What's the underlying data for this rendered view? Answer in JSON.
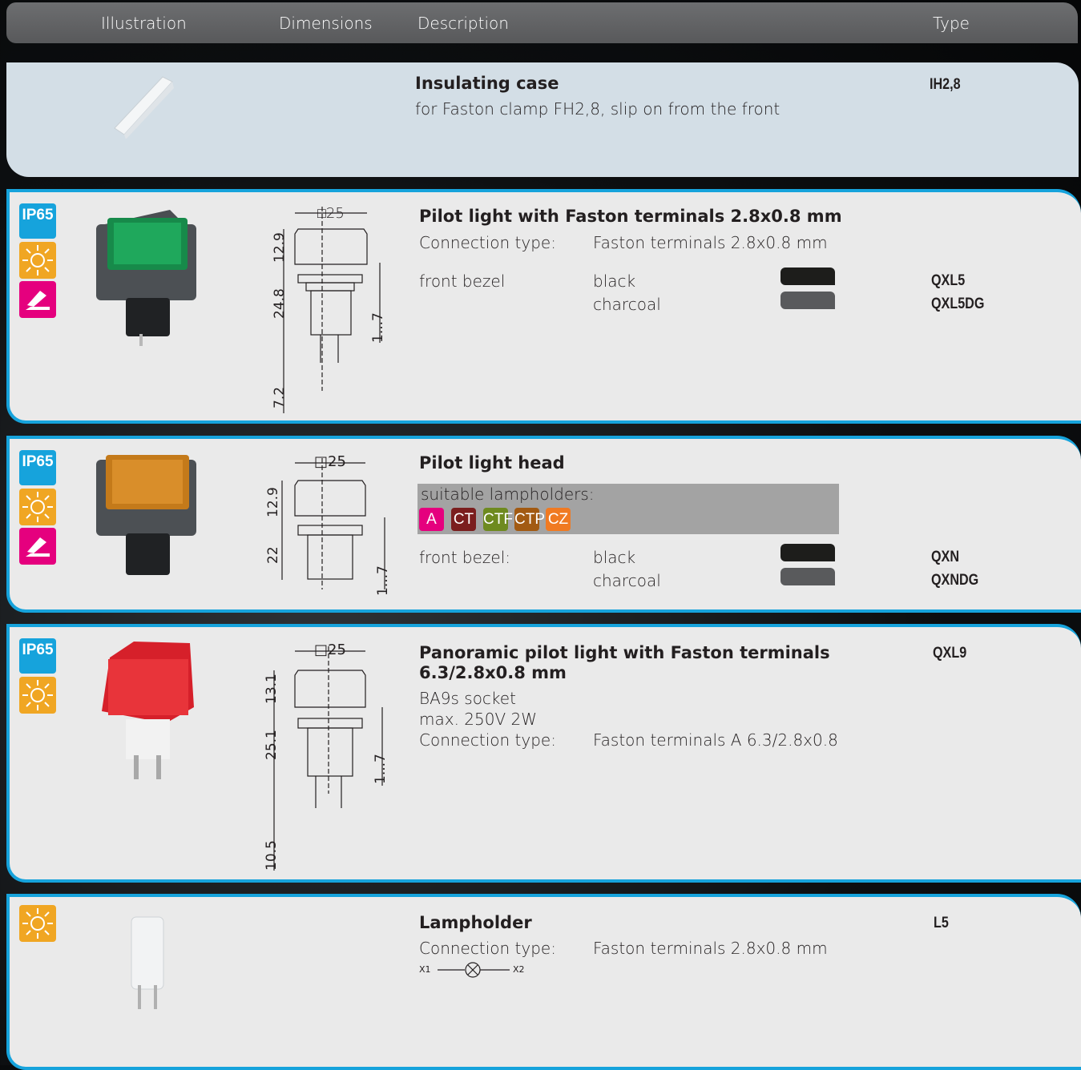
{
  "header": {
    "illustration": "Illustration",
    "dimensions": "Dimensions",
    "description": "Description",
    "type": "Type"
  },
  "colors": {
    "accent": "#16a3dc",
    "sun": "#f0a623",
    "edit": "#e5007e",
    "black": "#1d1d1b",
    "charcoal": "#595a5c"
  },
  "row1": {
    "title": "Insulating case",
    "desc": "for Faston clamp FH2,8, slip on from the front",
    "type": "IH2,8"
  },
  "row2": {
    "badge": "IP65",
    "icons": [
      "sun-icon",
      "hand-write-icon"
    ],
    "title": "Pilot light with Faston terminals 2.8x0.8 mm",
    "conn_label": "Connection type:",
    "conn_value": "Faston terminals 2.8x0.8 mm",
    "bezel_label": "front bezel",
    "colors": [
      "black",
      "charcoal"
    ],
    "types": [
      "QXL5",
      "QXL5DG"
    ],
    "dims": {
      "square": "□25",
      "a": "12.9",
      "b": "24.8",
      "c": "7.2",
      "d": "1...7"
    }
  },
  "row3": {
    "badge": "IP65",
    "icons": [
      "sun-icon",
      "hand-write-icon"
    ],
    "title": "Pilot light head",
    "suitable": "suitable lampholders:",
    "lampholders": [
      "A",
      "CT",
      "CTF",
      "CTP",
      "CZ"
    ],
    "bezel_label": "front bezel:",
    "colors": [
      "black",
      "charcoal"
    ],
    "types": [
      "QXN",
      "QXNDG"
    ],
    "dims": {
      "square": "□25",
      "a": "12.9",
      "b": "22",
      "d": "1...7"
    }
  },
  "row4": {
    "badge": "IP65",
    "icons": [
      "sun-icon"
    ],
    "title_1": "Panoramic pilot light with Faston terminals",
    "title_2": "6.3/2.8x0.8 mm",
    "line1": "BA9s socket",
    "line2": "max. 250V 2W",
    "conn_label": "Connection type:",
    "conn_value": "Faston terminals A 6.3/2.8x0.8",
    "type": "QXL9",
    "dims": {
      "square": "□25",
      "a": "13.1",
      "b": "25.1",
      "c": "10.5",
      "d": "1...7"
    }
  },
  "row5": {
    "icons": [
      "sun-icon"
    ],
    "title": "Lampholder",
    "conn_label": "Connection type:",
    "conn_value": "Faston terminals 2.8x0.8 mm",
    "x1": "X1",
    "x2": "X2",
    "type": "L5"
  }
}
